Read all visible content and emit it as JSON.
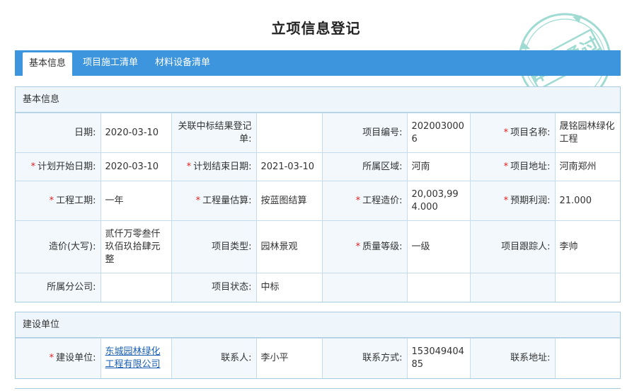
{
  "page_title": "立项信息登记",
  "tabs": [
    {
      "label": "基本信息",
      "active": true
    },
    {
      "label": "项目施工清单",
      "active": false
    },
    {
      "label": "材料设备清单",
      "active": false
    }
  ],
  "stamp": {
    "text": "审核通过",
    "color": "#7fcfc3"
  },
  "colors": {
    "tab_bar": "#3d95dd",
    "required": "#e02020",
    "border": "#a9cce3"
  },
  "basic": {
    "header": "基本信息",
    "fields": {
      "date": {
        "label": "日期:",
        "value": "2020-03-10"
      },
      "bid_result": {
        "label": "关联中标结果登记单:",
        "value": ""
      },
      "project_no": {
        "label": "项目编号:",
        "value": "2020030006"
      },
      "project_name": {
        "label": "项目名称:",
        "value": "晟铭园林绿化工程"
      },
      "plan_start": {
        "label": "计划开始日期:",
        "value": "2020-03-10"
      },
      "plan_end": {
        "label": "计划结束日期:",
        "value": "2021-03-10"
      },
      "region": {
        "label": "所属区域:",
        "value": "河南"
      },
      "address": {
        "label": "项目地址:",
        "value": "河南郑州"
      },
      "duration": {
        "label": "工程工期:",
        "value": "一年"
      },
      "estimate": {
        "label": "工程量估算:",
        "value": "按蓝图结算"
      },
      "cost": {
        "label": "工程造价:",
        "value": "20,003,994.000"
      },
      "profit": {
        "label": "预期利润:",
        "value": "21.000"
      },
      "cost_upper": {
        "label": "造价(大写):",
        "value": "贰仟万零叁仟玖佰玖拾肆元整"
      },
      "project_type": {
        "label": "项目类型:",
        "value": "园林景观"
      },
      "quality": {
        "label": "质量等级:",
        "value": "一级"
      },
      "tracker": {
        "label": "项目跟踪人:",
        "value": "李帅"
      },
      "branch": {
        "label": "所属分公司:",
        "value": ""
      },
      "status": {
        "label": "项目状态:",
        "value": "中标"
      }
    }
  },
  "builder": {
    "header": "建设单位",
    "fields": {
      "unit": {
        "label": "建设单位:",
        "value": "东城园林绿化工程有限公司"
      },
      "contact": {
        "label": "联系人:",
        "value": "李小平"
      },
      "phone": {
        "label": "联系方式:",
        "value": "15304940485"
      },
      "contact_addr": {
        "label": "联系地址:",
        "value": ""
      }
    }
  }
}
